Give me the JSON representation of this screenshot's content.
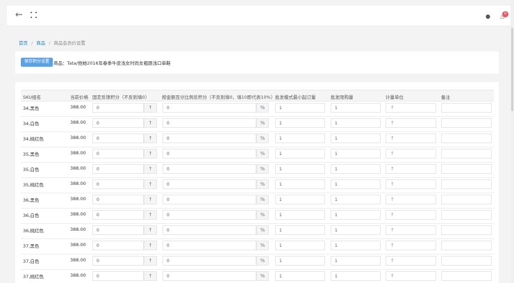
{
  "header": {
    "back_icon": "arrow-left-icon",
    "fullscreen_icon": "expand-icon",
    "user_icon": "user-icon",
    "notification_icon": "bell-icon",
    "notification_count": "0"
  },
  "breadcrumb": [
    "首页",
    "商品",
    "商品会员价设置"
  ],
  "product": {
    "save_label": "保存积分设置",
    "product_prefix": "商品：",
    "product_name": "Tata/他她2016年春季牛皮浅女时尚女粗跟浅口单鞋"
  },
  "table": {
    "columns": [
      "SKU组名",
      "当前价格",
      "固定反馈积分（不反则填0）",
      "按金额百分比例反积分（不反则填0，填10即代表10%）",
      "批发模式最小起订量",
      "批发限购量",
      "计量单位",
      "备注"
    ],
    "percent_sign": "%",
    "rows": [
      {
        "sku": "34,黑色",
        "price": "388.00",
        "points": "0",
        "percent": "0",
        "min_qty": "1",
        "limit_qty": "1"
      },
      {
        "sku": "34,白色",
        "price": "388.00",
        "points": "0",
        "percent": "0",
        "min_qty": "1",
        "limit_qty": "1"
      },
      {
        "sku": "34,桃红色",
        "price": "388.00",
        "points": "0",
        "percent": "0",
        "min_qty": "1",
        "limit_qty": "1"
      },
      {
        "sku": "35,黑色",
        "price": "388.00",
        "points": "0",
        "percent": "0",
        "min_qty": "1",
        "limit_qty": "1"
      },
      {
        "sku": "35,白色",
        "price": "388.00",
        "points": "0",
        "percent": "0",
        "min_qty": "1",
        "limit_qty": "1"
      },
      {
        "sku": "35,桃红色",
        "price": "388.00",
        "points": "0",
        "percent": "0",
        "min_qty": "1",
        "limit_qty": "1"
      },
      {
        "sku": "36,黑色",
        "price": "388.00",
        "points": "0",
        "percent": "0",
        "min_qty": "1",
        "limit_qty": "1"
      },
      {
        "sku": "36,白色",
        "price": "388.00",
        "points": "0",
        "percent": "0",
        "min_qty": "1",
        "limit_qty": "1"
      },
      {
        "sku": "36,桃红色",
        "price": "388.00",
        "points": "0",
        "percent": "0",
        "min_qty": "1",
        "limit_qty": "1"
      },
      {
        "sku": "37,黑色",
        "price": "388.00",
        "points": "0",
        "percent": "0",
        "min_qty": "1",
        "limit_qty": "1"
      },
      {
        "sku": "37,白色",
        "price": "388.00",
        "points": "0",
        "percent": "0",
        "min_qty": "1",
        "limit_qty": "1"
      },
      {
        "sku": "37,桃红色",
        "price": "388.00",
        "points": "0",
        "percent": "0",
        "min_qty": "1",
        "limit_qty": "1"
      }
    ]
  },
  "colors": {
    "accent": "#5aa2e6",
    "link": "#1c84c6",
    "badge": "#ed5565"
  }
}
